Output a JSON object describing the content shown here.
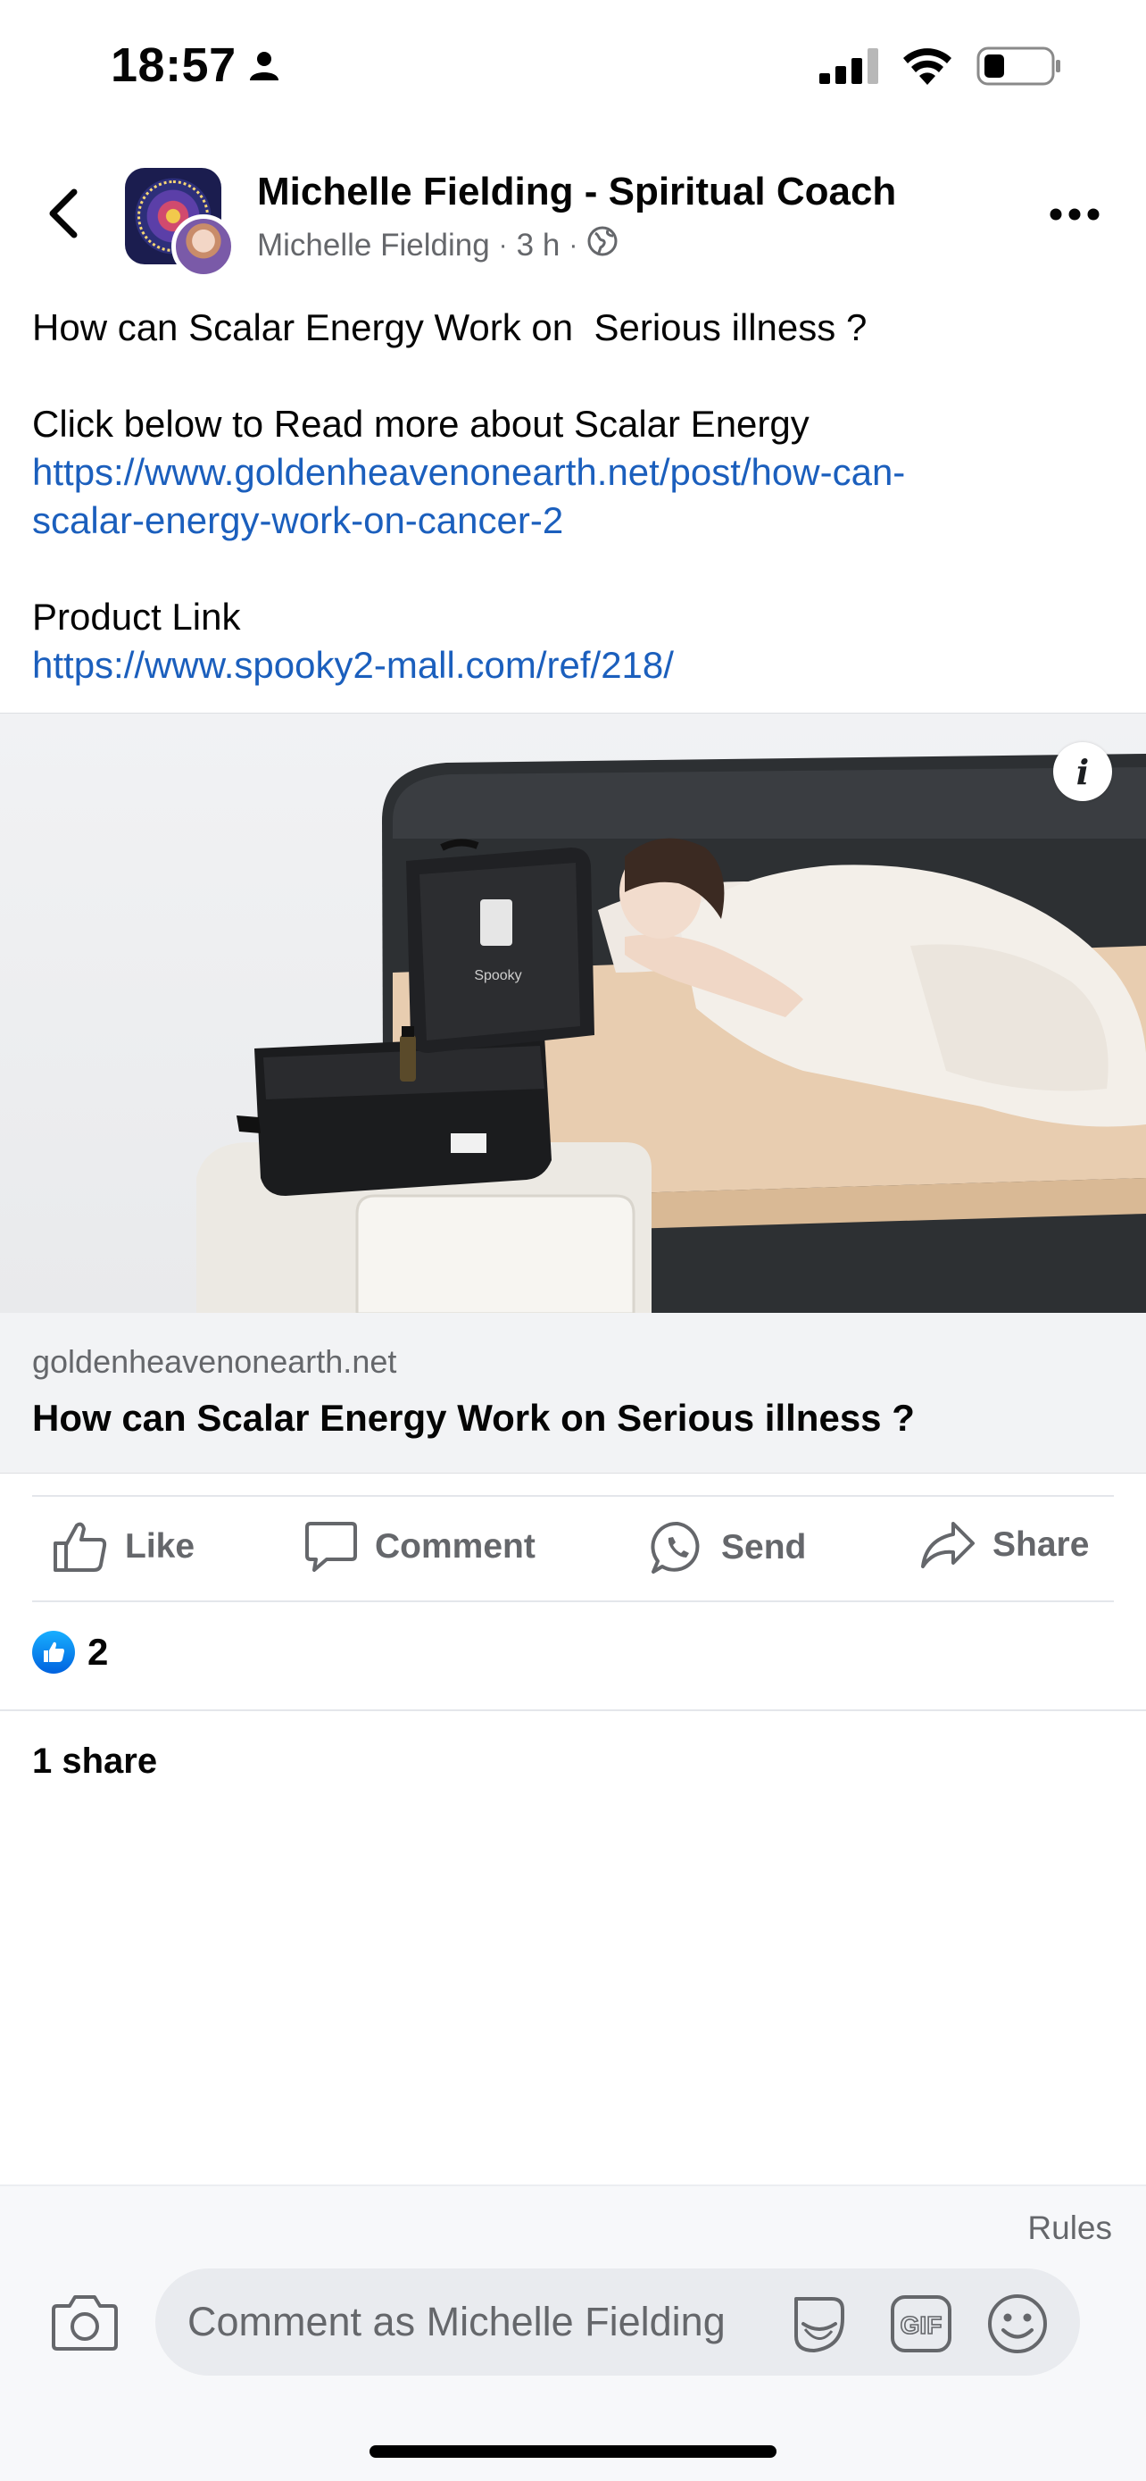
{
  "status_bar": {
    "time": "18:57"
  },
  "header": {
    "author_name": "Michelle Fielding - Spiritual Coach",
    "sub_author": "Michelle Fielding",
    "time_ago": "3 h",
    "separator": "·",
    "audience_icon": "globe-icon"
  },
  "post": {
    "line1": "How can Scalar Energy Work on  Serious illness ?",
    "line2": "Click below to Read more about Scalar Energy",
    "link1_part1": "https://www.goldenheavenonearth.net/post/how-can-",
    "link1_part2": "scalar-energy-work-on-cancer-2",
    "line3": "Product Link",
    "link2": "https://www.spooky2-mall.com/ref/218/"
  },
  "link_preview": {
    "image_logo_text": "Spooky",
    "domain": "goldenheavenonearth.net",
    "title": "How can Scalar Energy Work on Serious illness ?"
  },
  "actions": {
    "like": "Like",
    "comment": "Comment",
    "send": "Send",
    "share": "Share"
  },
  "stats": {
    "reactions_count": "2",
    "shares": "1 share"
  },
  "composer": {
    "rules": "Rules",
    "placeholder": "Comment as Michelle Fielding",
    "gif_label": "GIF"
  },
  "colors": {
    "link": "#1b5fbd",
    "secondary_text": "#65676b",
    "like_blue": "#0866ff"
  }
}
